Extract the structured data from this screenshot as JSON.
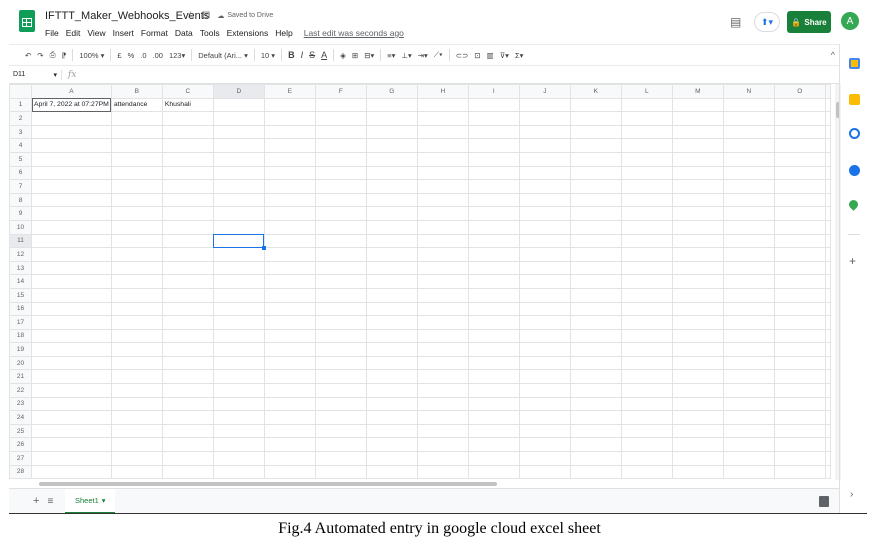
{
  "app": {
    "doc_title": "IFTTT_Maker_Webhooks_Events",
    "saved_status": "Saved to Drive",
    "last_edit": "Last edit was seconds ago",
    "menu": [
      "File",
      "Edit",
      "View",
      "Insert",
      "Format",
      "Data",
      "Tools",
      "Extensions",
      "Help"
    ],
    "share_label": "Share",
    "avatar_initial": "A",
    "brand_color": "#0f9d58",
    "share_color": "#188038"
  },
  "toolbar": {
    "undo": "↶",
    "redo": "↷",
    "print": "⎙",
    "paint_format": "🖌",
    "zoom": "100%",
    "currency": "£",
    "percent": "%",
    "dec_less": ".0",
    "dec_more": ".00",
    "more_formats": "123",
    "font": "Default (Ari...",
    "font_size": "10",
    "bold": "B",
    "italic": "I",
    "strike": "S",
    "text_color": "A",
    "collapse": "^"
  },
  "formula_bar": {
    "cell_ref": "D11",
    "fx": "fx",
    "value": ""
  },
  "grid": {
    "columns": [
      "A",
      "B",
      "C",
      "D",
      "E",
      "F",
      "G",
      "H",
      "I",
      "J",
      "K",
      "L",
      "M",
      "N",
      "O"
    ],
    "selected_column": "D",
    "selected_row": 11,
    "row_count": 28,
    "rows": [
      [
        "April 7, 2022 at 07:27PM",
        "attendance",
        "Khushali"
      ]
    ]
  },
  "sheets": {
    "add": "+",
    "list": "≡",
    "tabs": [
      {
        "name": "Sheet1"
      }
    ]
  },
  "side_panel": {
    "add": "+",
    "expand": "›"
  },
  "caption": "Fig.4 Automated entry in google cloud excel sheet"
}
